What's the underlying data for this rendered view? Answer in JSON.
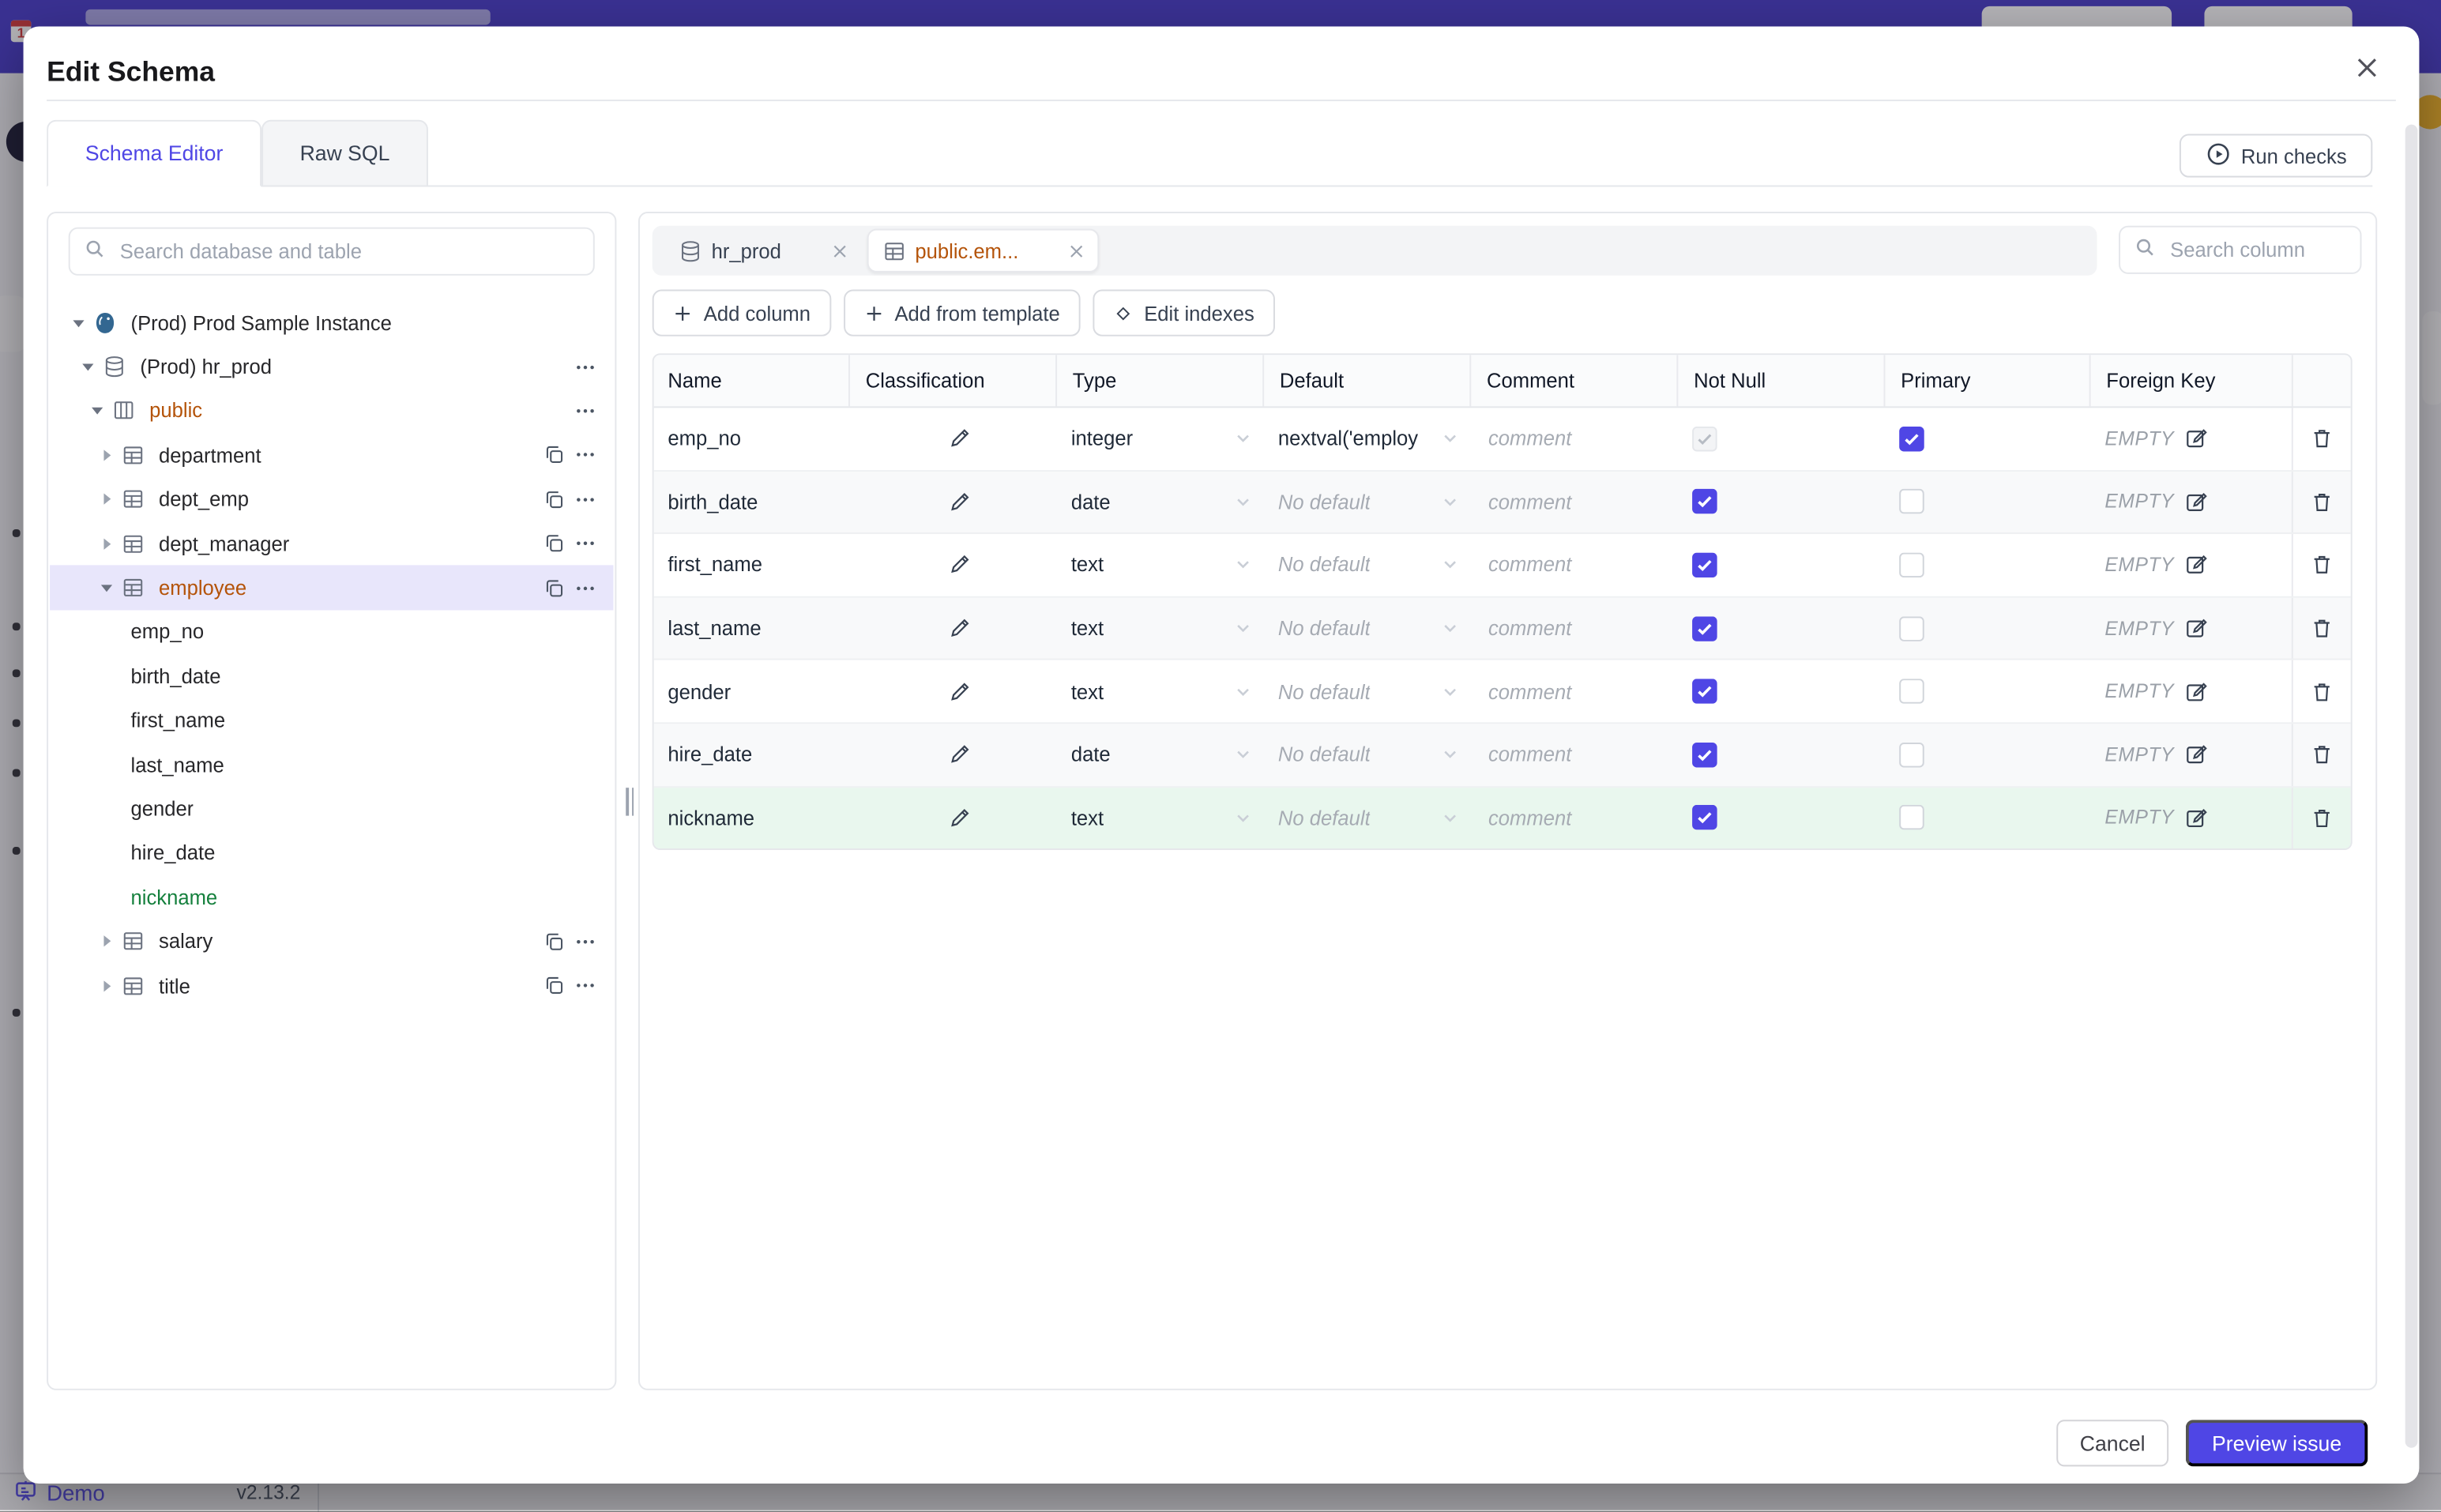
{
  "colors": {
    "accent": "#4f46e5",
    "amber": "#b45309",
    "green": "#15803d",
    "selected_row_bg": "#e8e6fb",
    "new_row_bg": "#e9f7ee",
    "topbar": "#4a3fc8"
  },
  "backdrop": {
    "calendar_day": "1",
    "demo_label": "Demo",
    "version": "v2.13.2"
  },
  "modal": {
    "title": "Edit Schema",
    "tabs": [
      {
        "label": "Schema Editor",
        "active": true
      },
      {
        "label": "Raw SQL",
        "active": false
      }
    ],
    "run_checks_label": "Run checks",
    "footer": {
      "cancel_label": "Cancel",
      "preview_label": "Preview issue"
    }
  },
  "sidebar": {
    "search_placeholder": "Search database and table",
    "tree": [
      {
        "label": "(Prod) Prod Sample Instance",
        "type": "instance",
        "depth": 0,
        "caret": "down",
        "icon": "postgres"
      },
      {
        "label": "(Prod) hr_prod",
        "type": "database",
        "depth": 1,
        "caret": "down",
        "icon": "database",
        "menu": true
      },
      {
        "label": "public",
        "type": "schema",
        "depth": 2,
        "caret": "down",
        "icon": "schema",
        "color": "amber",
        "menu": true
      },
      {
        "label": "department",
        "type": "table",
        "depth": 3,
        "caret": "right",
        "icon": "table",
        "copy": true,
        "menu": true
      },
      {
        "label": "dept_emp",
        "type": "table",
        "depth": 3,
        "caret": "right",
        "icon": "table",
        "copy": true,
        "menu": true
      },
      {
        "label": "dept_manager",
        "type": "table",
        "depth": 3,
        "caret": "right",
        "icon": "table",
        "copy": true,
        "menu": true
      },
      {
        "label": "employee",
        "type": "table",
        "depth": 3,
        "caret": "down",
        "icon": "table",
        "color": "amber",
        "selected": true,
        "copy": true,
        "menu": true
      },
      {
        "label": "emp_no",
        "type": "column",
        "depth": 4
      },
      {
        "label": "birth_date",
        "type": "column",
        "depth": 4
      },
      {
        "label": "first_name",
        "type": "column",
        "depth": 4
      },
      {
        "label": "last_name",
        "type": "column",
        "depth": 4
      },
      {
        "label": "gender",
        "type": "column",
        "depth": 4
      },
      {
        "label": "hire_date",
        "type": "column",
        "depth": 4
      },
      {
        "label": "nickname",
        "type": "column",
        "depth": 4,
        "color": "green"
      },
      {
        "label": "salary",
        "type": "table",
        "depth": 3,
        "caret": "right",
        "icon": "table",
        "copy": true,
        "menu": true
      },
      {
        "label": "title",
        "type": "table",
        "depth": 3,
        "caret": "right",
        "icon": "table",
        "copy": true,
        "menu": true
      }
    ]
  },
  "editor": {
    "chips": [
      {
        "label": "hr_prod",
        "icon": "database",
        "active": false
      },
      {
        "label": "public.em...",
        "icon": "table",
        "active": true
      }
    ],
    "search_placeholder": "Search column",
    "actions": [
      {
        "label": "Add column",
        "icon": "plus"
      },
      {
        "label": "Add from template",
        "icon": "plus"
      },
      {
        "label": "Edit indexes",
        "icon": "diamond"
      }
    ],
    "columns": [
      "Name",
      "Classification",
      "Type",
      "Default",
      "Comment",
      "Not Null",
      "Primary",
      "Foreign Key"
    ],
    "comment_placeholder": "comment",
    "rows": [
      {
        "name": "emp_no",
        "type": "integer",
        "default": {
          "value": "nextval('employ",
          "placeholder": false
        },
        "fk": "EMPTY",
        "not_null": {
          "checked": true,
          "disabled": true
        },
        "primary": {
          "checked": true
        }
      },
      {
        "name": "birth_date",
        "type": "date",
        "default": {
          "value": "No default",
          "placeholder": true
        },
        "fk": "EMPTY",
        "not_null": {
          "checked": true,
          "disabled": false
        },
        "primary": {
          "checked": false
        }
      },
      {
        "name": "first_name",
        "type": "text",
        "default": {
          "value": "No default",
          "placeholder": true
        },
        "fk": "EMPTY",
        "not_null": {
          "checked": true,
          "disabled": false
        },
        "primary": {
          "checked": false
        }
      },
      {
        "name": "last_name",
        "type": "text",
        "default": {
          "value": "No default",
          "placeholder": true
        },
        "fk": "EMPTY",
        "not_null": {
          "checked": true,
          "disabled": false
        },
        "primary": {
          "checked": false
        }
      },
      {
        "name": "gender",
        "type": "text",
        "default": {
          "value": "No default",
          "placeholder": true
        },
        "fk": "EMPTY",
        "not_null": {
          "checked": true,
          "disabled": false
        },
        "primary": {
          "checked": false
        }
      },
      {
        "name": "hire_date",
        "type": "date",
        "default": {
          "value": "No default",
          "placeholder": true
        },
        "fk": "EMPTY",
        "not_null": {
          "checked": true,
          "disabled": false
        },
        "primary": {
          "checked": false
        }
      },
      {
        "name": "nickname",
        "type": "text",
        "default": {
          "value": "No default",
          "placeholder": true
        },
        "fk": "EMPTY",
        "not_null": {
          "checked": true,
          "disabled": false
        },
        "primary": {
          "checked": false
        },
        "highlight": true
      }
    ]
  }
}
